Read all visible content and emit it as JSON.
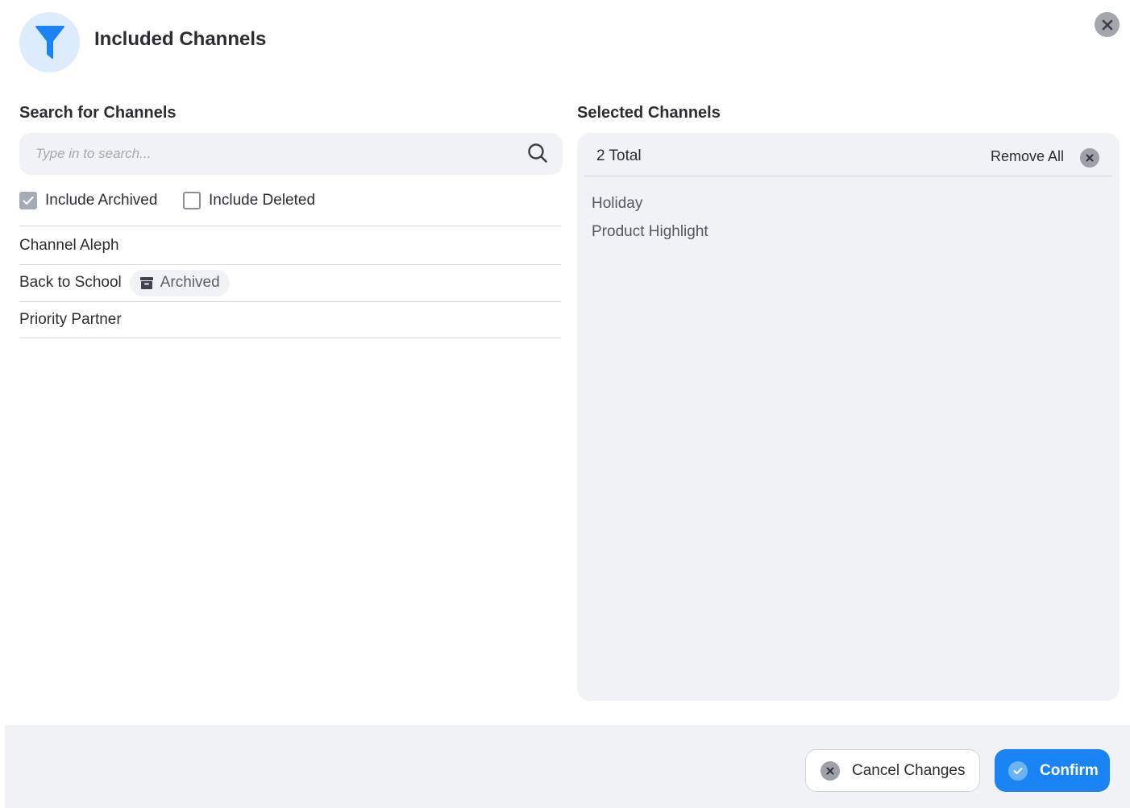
{
  "header": {
    "title": "Included Channels",
    "icon": "filter-icon",
    "icon_color": "#1a84f5",
    "icon_bg": "#dcecfd"
  },
  "search_panel": {
    "label": "Search for Channels",
    "placeholder": "Type in to search...",
    "value": "",
    "filters": [
      {
        "label": "Include Archived",
        "checked": true
      },
      {
        "label": "Include Deleted",
        "checked": false
      }
    ],
    "results": [
      {
        "name": "Channel Aleph",
        "badge": null
      },
      {
        "name": "Back to School",
        "badge": "Archived"
      },
      {
        "name": "Priority Partner",
        "badge": null
      }
    ]
  },
  "selected_panel": {
    "label": "Selected Channels",
    "total": "2 Total",
    "remove_all": "Remove All",
    "items": [
      "Holiday",
      "Product Highlight"
    ]
  },
  "footer": {
    "cancel_label": "Cancel Changes",
    "confirm_label": "Confirm",
    "confirm_color": "#1a84f5"
  }
}
